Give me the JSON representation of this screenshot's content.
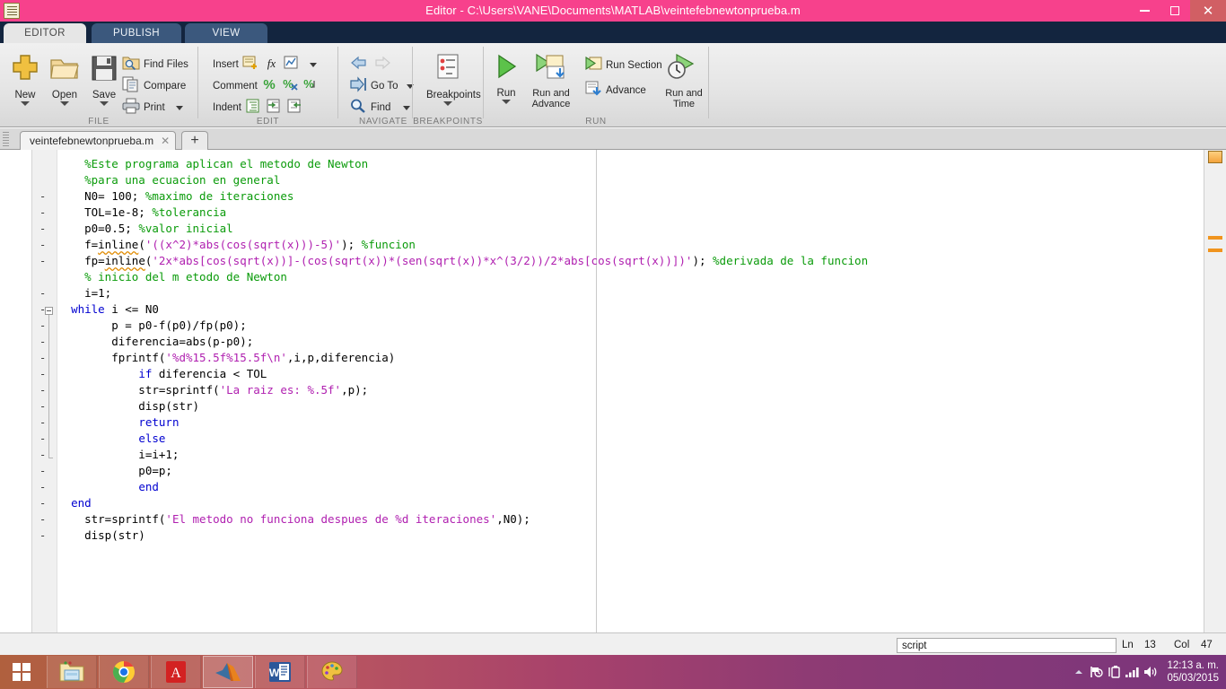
{
  "window": {
    "title": "Editor - C:\\Users\\VANE\\Documents\\MATLAB\\veintefebnewtonprueba.m",
    "icon": "matlab-editor-icon",
    "minimize": "–",
    "maximize": "❐",
    "close": "✕",
    "titlebar_color": "#f7418c",
    "close_color": "#d15f64"
  },
  "ribbon_tabs": [
    {
      "label": "EDITOR",
      "active": true
    },
    {
      "label": "PUBLISH",
      "active": false
    },
    {
      "label": "VIEW",
      "active": false
    }
  ],
  "quick_access": [
    {
      "name": "new-script-icon"
    },
    {
      "name": "save-icon"
    },
    {
      "name": "cut-icon"
    },
    {
      "name": "copy-icon"
    },
    {
      "name": "paste-icon"
    },
    {
      "name": "undo-icon"
    },
    {
      "name": "redo-icon"
    },
    {
      "name": "switch-window-icon"
    },
    {
      "name": "help-icon"
    },
    {
      "name": "customize-icon"
    },
    {
      "name": "minimize-ribbon-icon"
    }
  ],
  "ribbon": {
    "groups": [
      {
        "label": "FILE"
      },
      {
        "label": "EDIT"
      },
      {
        "label": "NAVIGATE"
      },
      {
        "label": "BREAKPOINTS"
      },
      {
        "label": "RUN"
      }
    ],
    "file": {
      "new": "New",
      "open": "Open",
      "save": "Save",
      "find_files": "Find Files",
      "compare": "Compare",
      "print": "Print"
    },
    "edit": {
      "insert": "Insert",
      "comment": "Comment",
      "indent": "Indent"
    },
    "navigate": {
      "go_to": "Go To",
      "find": "Find"
    },
    "breakpoints": {
      "breakpoints": "Breakpoints"
    },
    "run": {
      "run": "Run",
      "run_and_advance": "Run and\nAdvance",
      "run_section": "Run Section",
      "advance": "Advance",
      "run_and_time": "Run and\nTime"
    }
  },
  "document_tabs": {
    "tabs": [
      {
        "name": "veintefebnewtonprueba.m",
        "close": "✕"
      }
    ],
    "new_tab": "+"
  },
  "code": {
    "lines": [
      {
        "n": 1,
        "executable": false,
        "tokens": [
          {
            "t": "    %Este programa aplican el metodo de Newton",
            "c": "cm"
          }
        ]
      },
      {
        "n": 2,
        "executable": false,
        "tokens": [
          {
            "t": "    %para una ecuacion en general",
            "c": "cm"
          }
        ]
      },
      {
        "n": 3,
        "executable": true,
        "tokens": [
          {
            "t": "    N0= 100; ",
            "c": "pl"
          },
          {
            "t": "%maximo de iteraciones",
            "c": "cm"
          }
        ]
      },
      {
        "n": 4,
        "executable": true,
        "tokens": [
          {
            "t": "    TOL=1e-8; ",
            "c": "pl"
          },
          {
            "t": "%tolerancia",
            "c": "cm"
          }
        ]
      },
      {
        "n": 5,
        "executable": true,
        "tokens": [
          {
            "t": "    p0=0.5; ",
            "c": "pl"
          },
          {
            "t": "%valor inicial",
            "c": "cm"
          }
        ]
      },
      {
        "n": 6,
        "executable": true,
        "tokens": [
          {
            "t": "    f=",
            "c": "pl"
          },
          {
            "t": "inline",
            "c": "pl under"
          },
          {
            "t": "(",
            "c": "pl"
          },
          {
            "t": "'((x^2)*abs(cos(sqrt(x)))-5)'",
            "c": "st"
          },
          {
            "t": "); ",
            "c": "pl"
          },
          {
            "t": "%funcion",
            "c": "cm"
          }
        ]
      },
      {
        "n": 7,
        "executable": true,
        "tokens": [
          {
            "t": "    fp=",
            "c": "pl"
          },
          {
            "t": "inline",
            "c": "pl under"
          },
          {
            "t": "(",
            "c": "pl"
          },
          {
            "t": "'2x*abs[cos(sqrt(x))]-(cos(sqrt(x))*(sen(sqrt(x))*x^(3/2))/2*abs[cos(sqrt(x))])'",
            "c": "st"
          },
          {
            "t": "); ",
            "c": "pl"
          },
          {
            "t": "%derivada de la funcion",
            "c": "cm"
          }
        ]
      },
      {
        "n": 8,
        "executable": false,
        "tokens": [
          {
            "t": "    % inicio del m etodo de Newton",
            "c": "cm"
          }
        ]
      },
      {
        "n": 9,
        "executable": true,
        "tokens": [
          {
            "t": "    i=1;",
            "c": "pl"
          }
        ]
      },
      {
        "n": 10,
        "executable": true,
        "tokens": [
          {
            "t": "  ",
            "c": "pl"
          },
          {
            "t": "while",
            "c": "kw"
          },
          {
            "t": " i <= N0",
            "c": "pl"
          }
        ]
      },
      {
        "n": 11,
        "executable": true,
        "tokens": [
          {
            "t": "        p = p0-f(p0)/fp(p0);",
            "c": "pl"
          }
        ]
      },
      {
        "n": 12,
        "executable": true,
        "tokens": [
          {
            "t": "        diferencia=abs(p-p0);",
            "c": "pl"
          }
        ]
      },
      {
        "n": 13,
        "executable": true,
        "tokens": [
          {
            "t": "        fprintf(",
            "c": "pl"
          },
          {
            "t": "'%d%15.5f%15.5f\\n'",
            "c": "st"
          },
          {
            "t": ",i,p,diferencia)",
            "c": "pl"
          }
        ]
      },
      {
        "n": 14,
        "executable": true,
        "tokens": [
          {
            "t": "            ",
            "c": "pl"
          },
          {
            "t": "if",
            "c": "kw"
          },
          {
            "t": " diferencia < TOL",
            "c": "pl"
          }
        ]
      },
      {
        "n": 15,
        "executable": true,
        "tokens": [
          {
            "t": "            str=sprintf(",
            "c": "pl"
          },
          {
            "t": "'La raiz es: %.5f'",
            "c": "st"
          },
          {
            "t": ",p);",
            "c": "pl"
          }
        ]
      },
      {
        "n": 16,
        "executable": true,
        "tokens": [
          {
            "t": "            disp(str)",
            "c": "pl"
          }
        ]
      },
      {
        "n": 17,
        "executable": true,
        "tokens": [
          {
            "t": "            ",
            "c": "pl"
          },
          {
            "t": "return",
            "c": "kw"
          }
        ]
      },
      {
        "n": 18,
        "executable": true,
        "tokens": [
          {
            "t": "            ",
            "c": "pl"
          },
          {
            "t": "else",
            "c": "kw"
          }
        ]
      },
      {
        "n": 19,
        "executable": true,
        "tokens": [
          {
            "t": "            i=i+1;",
            "c": "pl"
          }
        ]
      },
      {
        "n": 20,
        "executable": true,
        "tokens": [
          {
            "t": "            p0=p;",
            "c": "pl"
          }
        ]
      },
      {
        "n": 21,
        "executable": true,
        "tokens": [
          {
            "t": "            ",
            "c": "pl"
          },
          {
            "t": "end",
            "c": "kw"
          }
        ]
      },
      {
        "n": 22,
        "executable": true,
        "tokens": [
          {
            "t": "  ",
            "c": "pl"
          },
          {
            "t": "end",
            "c": "kw"
          }
        ]
      },
      {
        "n": 23,
        "executable": true,
        "tokens": [
          {
            "t": "    str=sprintf(",
            "c": "pl"
          },
          {
            "t": "'El metodo no funciona despues de %d iteraciones'",
            "c": "st"
          },
          {
            "t": ",N0);",
            "c": "pl"
          }
        ]
      },
      {
        "n": 24,
        "executable": true,
        "tokens": [
          {
            "t": "    disp(str)",
            "c": "pl"
          }
        ]
      }
    ],
    "colors": {
      "comment": "#0a9b0a",
      "keyword": "#0000d0",
      "string": "#b020b0",
      "plain": "#000000",
      "warning_marker": "#f0941e"
    }
  },
  "status_bar": {
    "file_type": "script",
    "ln_label": "Ln",
    "ln_value": "13",
    "col_label": "Col",
    "col_value": "47"
  },
  "taskbar": {
    "start": "windows-start-icon",
    "items": [
      {
        "name": "file-explorer-icon",
        "active": false
      },
      {
        "name": "google-chrome-icon",
        "active": false
      },
      {
        "name": "adobe-reader-icon",
        "active": false
      },
      {
        "name": "matlab-icon",
        "active": true
      },
      {
        "name": "microsoft-word-icon",
        "active": false
      },
      {
        "name": "paint-icon",
        "active": false
      }
    ],
    "tray": {
      "show_hidden": "show-hidden-icons-icon",
      "icons": [
        "action-center-icon",
        "battery-icon",
        "network-icon",
        "volume-icon"
      ],
      "time": "12:13 a. m.",
      "date": "05/03/2015"
    }
  }
}
